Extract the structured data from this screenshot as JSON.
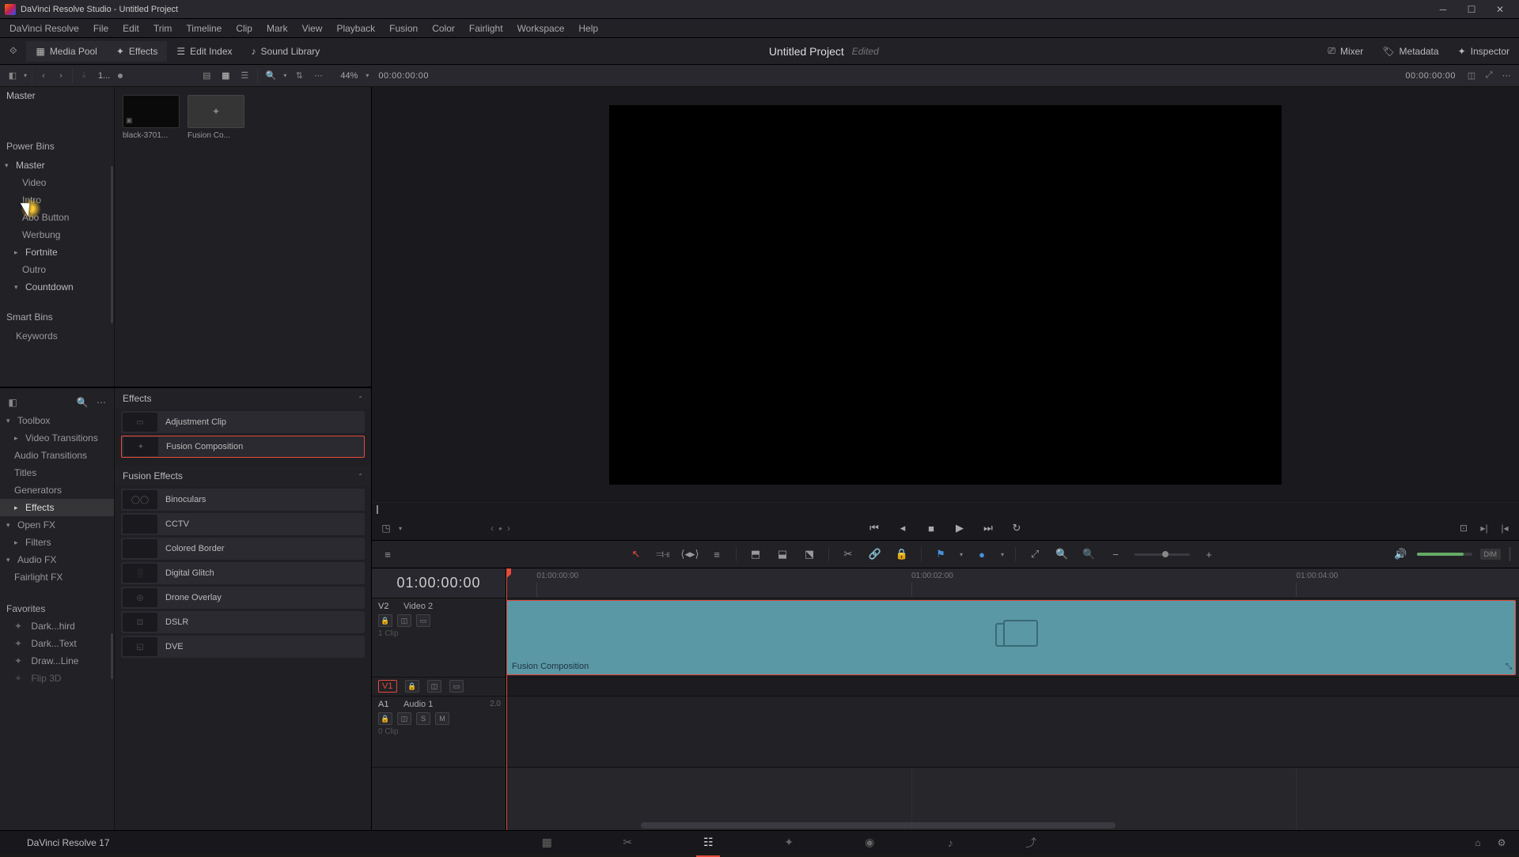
{
  "titlebar": {
    "text": "DaVinci Resolve Studio - Untitled Project"
  },
  "menu": [
    "DaVinci Resolve",
    "File",
    "Edit",
    "Trim",
    "Timeline",
    "Clip",
    "Mark",
    "View",
    "Playback",
    "Fusion",
    "Color",
    "Fairlight",
    "Workspace",
    "Help"
  ],
  "topbar": {
    "mediapool": "Media Pool",
    "effects": "Effects",
    "editindex": "Edit Index",
    "soundlib": "Sound Library",
    "project": "Untitled Project",
    "status": "Edited",
    "mixer": "Mixer",
    "metadata": "Metadata",
    "inspector": "Inspector"
  },
  "secbar": {
    "binpath": "1...",
    "zoom": "44%",
    "tc_left": "00:00:00:00",
    "tc_right": "00:00:00:00"
  },
  "bins": {
    "root": "Master",
    "power_label": "Power Bins",
    "power_root": "Master",
    "items": [
      "Video",
      "Intro",
      "Abo Button",
      "Werbung",
      "Fortnite",
      "Outro",
      "Countdown"
    ],
    "smart_label": "Smart Bins",
    "smart_items": [
      "Keywords"
    ]
  },
  "clips": [
    {
      "label": "black-3701..."
    },
    {
      "label": "Fusion Co..."
    }
  ],
  "effects_tree": {
    "top": "Toolbox",
    "items": [
      "Video Transitions",
      "Audio Transitions",
      "Titles",
      "Generators",
      "Effects",
      "Open FX",
      "Filters",
      "Audio FX",
      "Fairlight FX"
    ],
    "fav_label": "Favorites",
    "favs": [
      "Dark...hird",
      "Dark...Text",
      "Draw...Line",
      "Flip 3D"
    ]
  },
  "effects_list": {
    "h1": "Effects",
    "g1": [
      "Adjustment Clip",
      "Fusion Composition"
    ],
    "h2": "Fusion Effects",
    "g2": [
      "Binoculars",
      "CCTV",
      "Colored Border",
      "Digital Glitch",
      "Drone Overlay",
      "DSLR",
      "DVE"
    ]
  },
  "timeline": {
    "tc_big": "01:00:00:00",
    "ruler": [
      {
        "pos": 3,
        "label": "01:00:00:00"
      },
      {
        "pos": 40,
        "label": "01:00:02:00"
      },
      {
        "pos": 78,
        "label": "01:00:04:00"
      }
    ],
    "v2": {
      "id": "V2",
      "name": "Video 2",
      "sub": "1 Clip"
    },
    "v1": {
      "id": "V1"
    },
    "a1": {
      "id": "A1",
      "name": "Audio 1",
      "db": "2.0",
      "sub": "0 Clip"
    },
    "clip_label": "Fusion Composition"
  },
  "toolbar": {
    "dim": "DIM"
  },
  "bottom": {
    "version": "DaVinci Resolve 17"
  }
}
